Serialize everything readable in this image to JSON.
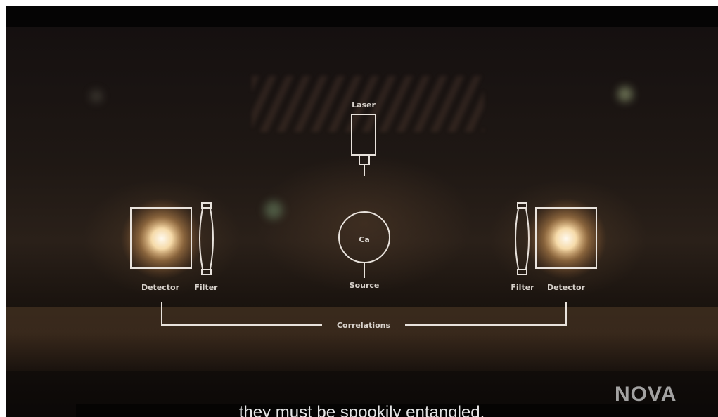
{
  "diagram": {
    "laser_label": "Laser",
    "source_label": "Source",
    "source_element": "Ca",
    "left_detector_label": "Detector",
    "left_filter_label": "Filter",
    "right_filter_label": "Filter",
    "right_detector_label": "Detector",
    "correlations_label": "Correlations"
  },
  "logo": {
    "text": "NOVA"
  },
  "subtitle": {
    "text": "they must be spookily entangled."
  },
  "colors": {
    "line": "#e8e2dc",
    "glow": "#ffe9c2",
    "background": "#050404"
  }
}
